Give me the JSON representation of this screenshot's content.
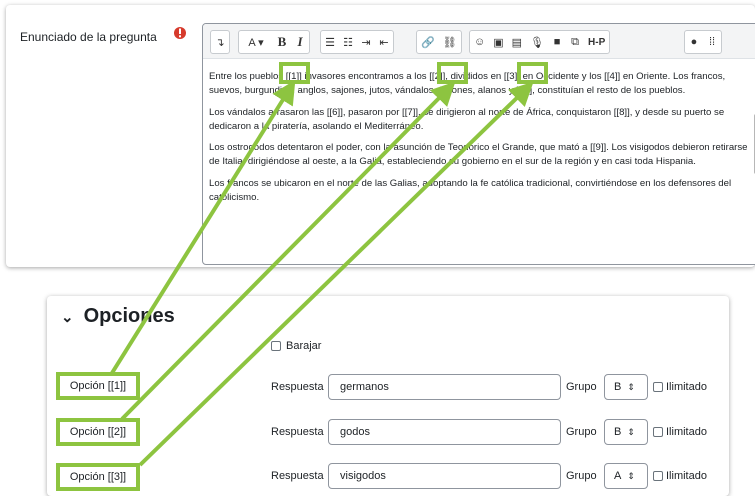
{
  "question": {
    "label": "Enunciado de la pregunta",
    "required_color": "#d63a2c"
  },
  "toolbar": {
    "buttons": [
      "↴",
      "A ▾",
      "B",
      "I",
      "☰",
      "☷",
      "⇥",
      "⇤",
      "🔗",
      "⛓",
      "☺",
      "▣",
      "▤",
      "🎙",
      "■",
      "⧉",
      "H-P",
      "●",
      "⁞⁞"
    ]
  },
  "editor": {
    "paragraphs": [
      "Entre los pueblos [[1]] invasores encontramos a los [[2]], divididos en [[3]] en Occidente y los [[4]] en Oriente. Los francos, suevos, burgundios, anglos, sajones, jutos, vándalos, frisones, alanos y [[5]],  constituían el resto de los pueblos.",
      "Los vándalos arrasaron las [[6]], pasaron por [[7]], se dirigieron al norte de África, conquistaron [[8]], y desde su puerto se dedicaron a la piratería, asolando el Mediterráneo.",
      "Los ostrogodos detentaron el poder, con la asunción de Teodorico el Grande, que mató a [[9]]. Los visigodos debieron retirarse de Italia, dirigiéndose al oeste, a la Galia, estableciendo su gobierno en el sur de la región y en casi toda Hispania.",
      "Los francos se ubicaron en el norte de las Galias, adoptando la fe católica tradicional, convirtiéndose en los defensores del catolicismo."
    ]
  },
  "options": {
    "section_title": "Opciones",
    "shuffle_label": "Barajar",
    "answer_label": "Respuesta",
    "group_label": "Grupo",
    "unlimited_label": "Ilimitado",
    "rows": [
      {
        "label": "Opción [[1]]",
        "answer": "germanos",
        "group": "B"
      },
      {
        "label": "Opción [[2]]",
        "answer": "godos",
        "group": "B"
      },
      {
        "label": "Opción [[3]]",
        "answer": "visigodos",
        "group": "A"
      }
    ]
  },
  "colors": {
    "highlight": "#8dc440",
    "arrow": "#8dc440"
  }
}
